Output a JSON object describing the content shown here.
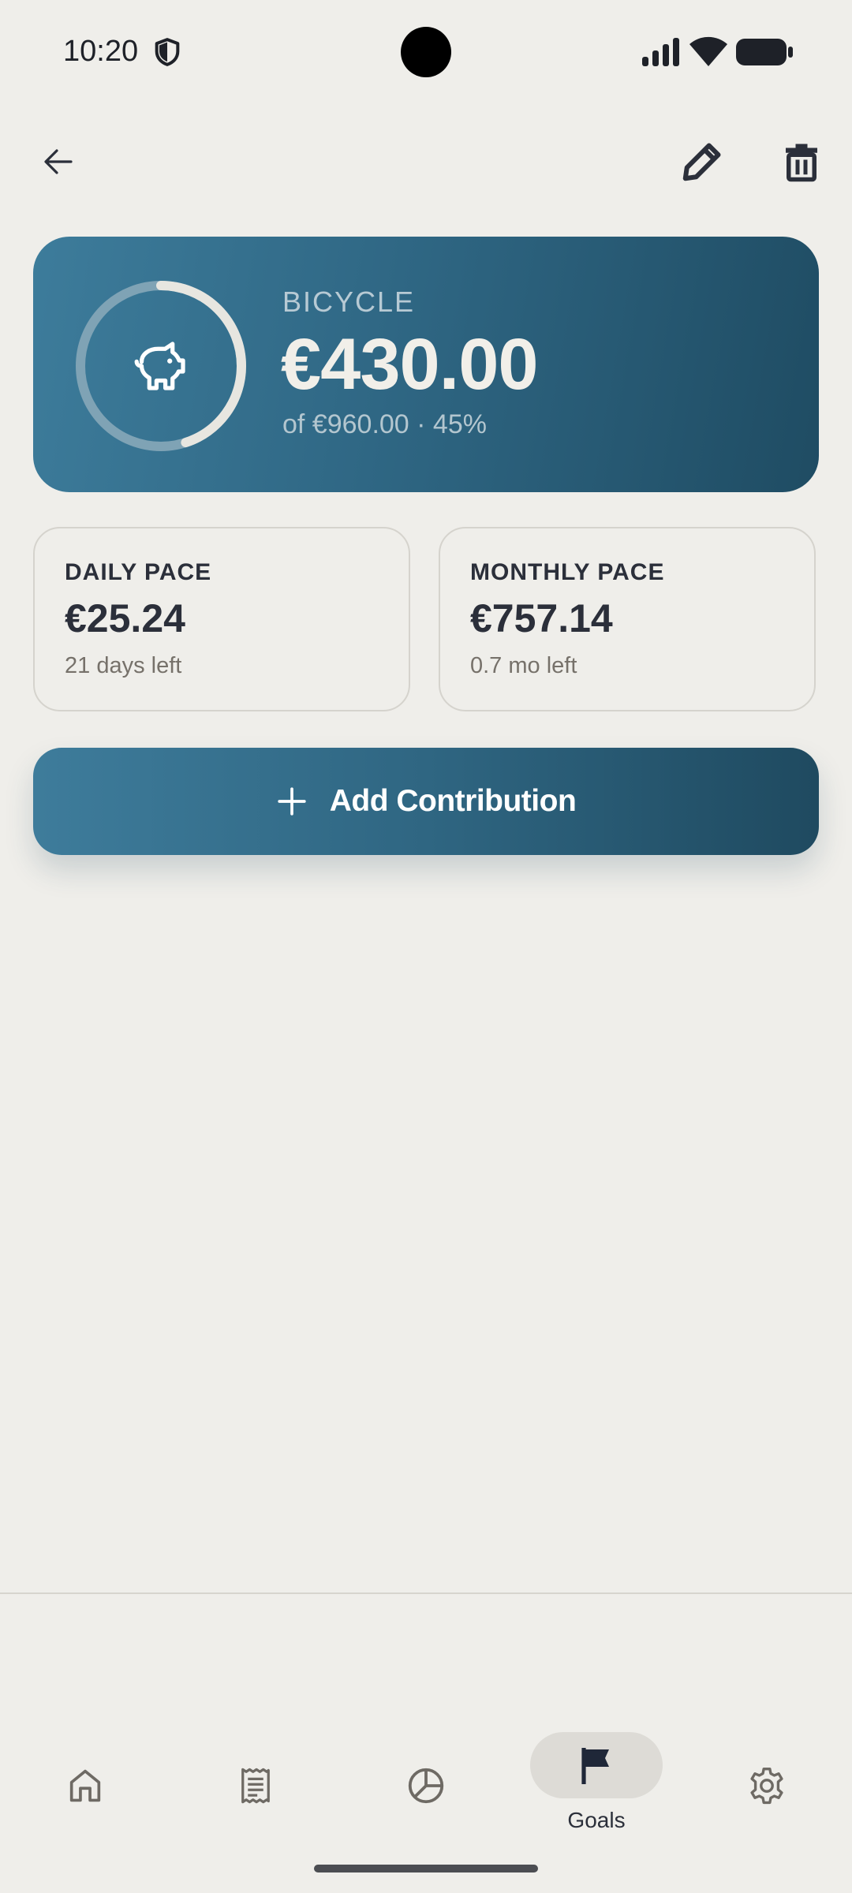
{
  "status_bar": {
    "time": "10:20",
    "icons": [
      "shield-icon",
      "signal-icon",
      "wifi-icon",
      "battery-icon"
    ]
  },
  "top_bar": {
    "icons": [
      "back-arrow-icon",
      "pencil-icon",
      "trash-icon"
    ]
  },
  "goal": {
    "name": "BICYCLE",
    "saved": "€430.00",
    "subtitle": "of €960.00 · 45%",
    "progress_percent": 45,
    "icon": "piggy-bank-icon"
  },
  "pace": {
    "daily": {
      "title": "DAILY PACE",
      "value": "€25.24",
      "note": "21 days left"
    },
    "monthly": {
      "title": "MONTHLY PACE",
      "value": "€757.14",
      "note": "0.7 mo left"
    }
  },
  "actions": {
    "add_contribution": "Add Contribution"
  },
  "bottom_nav": {
    "items": [
      {
        "icon": "home-icon"
      },
      {
        "icon": "receipt-icon"
      },
      {
        "icon": "pie-chart-icon"
      },
      {
        "icon": "flag-icon",
        "label": "Goals",
        "active": true
      },
      {
        "icon": "gear-icon"
      }
    ]
  },
  "colors": {
    "background": "#efeeea",
    "accent": "#2f6784",
    "accent_dark": "#1f4c63",
    "text": "#2b2f3a",
    "muted": "#76716a"
  }
}
